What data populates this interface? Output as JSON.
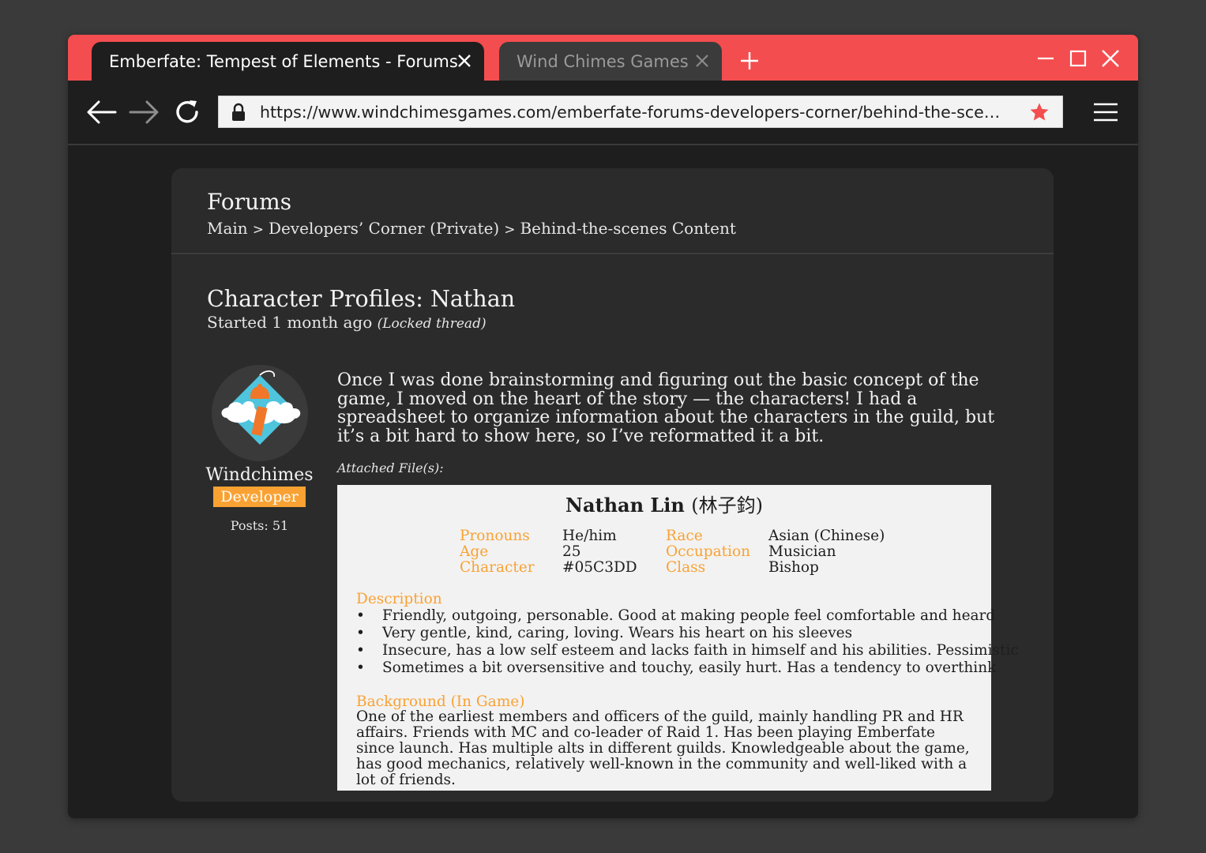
{
  "browser": {
    "tabs": [
      {
        "label": "Emberfate: Tempest of Elements - Forums",
        "active": true
      },
      {
        "label": "Wind Chimes Games",
        "active": false
      }
    ],
    "url": "https://www.windchimesgames.com/emberfate-forums-developers-corner/behind-the-scenes-content/character-profiles-nathan",
    "colors": {
      "titlebar": "#f44d4f",
      "bookmark_star": "#f44d4f"
    }
  },
  "forum": {
    "title": "Forums",
    "breadcrumb": [
      "Main",
      "Developers’ Corner (Private)",
      "Behind-the-scenes Content"
    ],
    "breadcrumb_separator": ">"
  },
  "thread": {
    "title": "Character Profiles: Nathan",
    "started": "Started 1 month ago",
    "status": "(Locked thread)"
  },
  "author": {
    "name": "Windchimes",
    "role": "Developer",
    "posts": "Posts: 51",
    "role_color": "#f9a233"
  },
  "post": {
    "body": "Once I was done brainstorming and figuring out the basic concept of the game, I moved on the heart of the story — the characters! I had a spreadsheet to organize information about the characters in the guild, but it’s a bit hard to show here, so I’ve reformatted it a bit.",
    "attachments_label": "Attached File(s):"
  },
  "profile": {
    "name": "Nathan Lin",
    "name_chinese": "(林子鈞)",
    "fields_left": [
      {
        "key": "Pronouns",
        "value": "He/him"
      },
      {
        "key": "Age",
        "value": "25"
      },
      {
        "key": "Character",
        "value": "#05C3DD"
      }
    ],
    "fields_right": [
      {
        "key": "Race",
        "value": "Asian (Chinese)"
      },
      {
        "key": "Occupation",
        "value": "Musician"
      },
      {
        "key": "Class",
        "value": "Bishop"
      }
    ],
    "description_heading": "Description",
    "description": [
      "Friendly, outgoing, personable. Good at making people feel comfortable and heard",
      "Very gentle, kind, caring, loving. Wears his heart on his sleeves",
      "Insecure, has a low self esteem and lacks faith in himself and his abilities. Pessimistic",
      "Sometimes a bit oversensitive and touchy, easily hurt. Has a tendency to overthink"
    ],
    "background_heading": "Background (In Game)",
    "background": "One of the earliest members and officers of the guild, mainly handling PR and HR affairs. Friends with MC and co-leader of Raid 1. Has been playing Emberfate since launch. Has multiple alts in different guilds. Knowledgeable about the game, has good mechanics, relatively well-known in the community and well-liked with a lot of friends."
  }
}
